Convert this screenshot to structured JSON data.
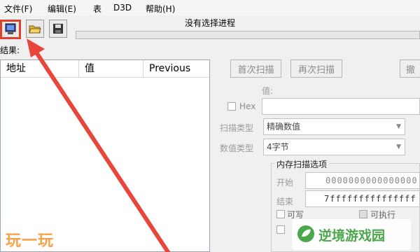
{
  "menu": [
    "文件(F)",
    "编辑(E)",
    "表",
    "D3D",
    "帮助(H)"
  ],
  "toolbar": {
    "process_title": "没有选择进程"
  },
  "results": {
    "label": "结果:",
    "columns": [
      "地址",
      "值",
      "Previous"
    ]
  },
  "scan": {
    "first_scan": "首次扫描",
    "next_scan": "再次扫描",
    "undo_scan": "撤",
    "value_label": "值:",
    "hex_label": "Hex",
    "scan_type_label": "扫描类型",
    "scan_type_value": "精确数值",
    "value_type_label": "数值类型",
    "value_type_value": "4字节"
  },
  "memory": {
    "title": "内存扫描选项",
    "start_label": "开始",
    "start_value": "0000000000000000",
    "stop_label": "结束",
    "stop_value": "7fffffffffffffff",
    "writable": "可写",
    "executable": "可执行"
  },
  "watermark": {
    "left": "玩一玩",
    "right": "逆境游戏园"
  },
  "colors": {
    "highlight": "#e0402a",
    "watermark_left": "#f5a24a",
    "watermark_right": "#4aa84a"
  }
}
